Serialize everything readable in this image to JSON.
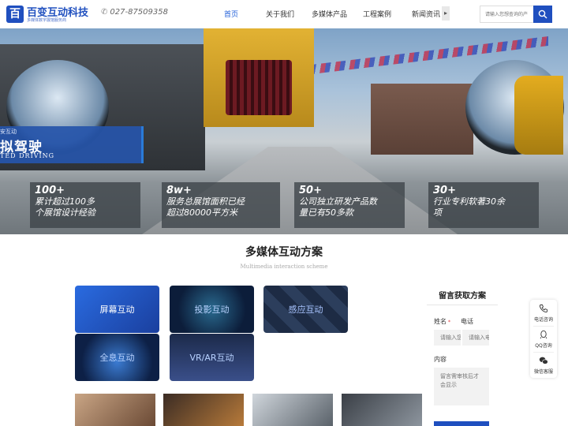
{
  "header": {
    "logo": {
      "name": "百变互动科技",
      "sub": "多媒体数字展馆服务商"
    },
    "phone": "027-87509358",
    "nav": [
      {
        "label": "首页",
        "active": true
      },
      {
        "label": "关于我们",
        "active": false
      },
      {
        "label": "多媒体产品",
        "active": false
      },
      {
        "label": "工程案例",
        "active": false
      },
      {
        "label": "新闻资讯",
        "active": false
      }
    ],
    "search_placeholder": "请输入您想查询的产",
    "icons": {
      "phone": "phone-icon",
      "search": "search-icon",
      "more": "chevron-right-icon"
    },
    "colors": {
      "brand": "#1f4fbf",
      "active_nav": "#1f5ed8"
    }
  },
  "banner": {
    "tag_sub": "安互动",
    "tag_title": "拟驾驶",
    "tag_en": "TED DRIVING",
    "stats": [
      {
        "num": "100+",
        "line1": "累计超过100多",
        "line2": "个展馆设计经验"
      },
      {
        "num": "8w+",
        "line1": "服务总展馆面积已经",
        "line2": "超过80000平方米"
      },
      {
        "num": "50+",
        "line1": "公司独立研发产品数",
        "line2": "量已有50多款"
      },
      {
        "num": "30+",
        "line1": "行业专利软著30余",
        "line2": "项"
      }
    ]
  },
  "solutions": {
    "title": "多媒体互动方案",
    "subtitle": "Multimedia interaction scheme",
    "items": [
      {
        "label": "屏幕互动"
      },
      {
        "label": "投影互动"
      },
      {
        "label": "感应互动"
      },
      {
        "label": "全息互动"
      },
      {
        "label": "VR/AR互动"
      }
    ]
  },
  "form": {
    "title": "留言获取方案",
    "name_label": "姓名",
    "phone_label": "电话",
    "name_placeholder": "请输入您",
    "phone_placeholder": "请输入电话",
    "content_label": "内容",
    "content_placeholder": "留言需审核后才会显示",
    "required_mark": "*"
  },
  "side_panel": {
    "items": [
      {
        "label": "电话咨询",
        "icon": "phone-icon"
      },
      {
        "label": "QQ咨询",
        "icon": "qq-icon"
      },
      {
        "label": "微信客服",
        "icon": "wechat-icon"
      }
    ]
  }
}
